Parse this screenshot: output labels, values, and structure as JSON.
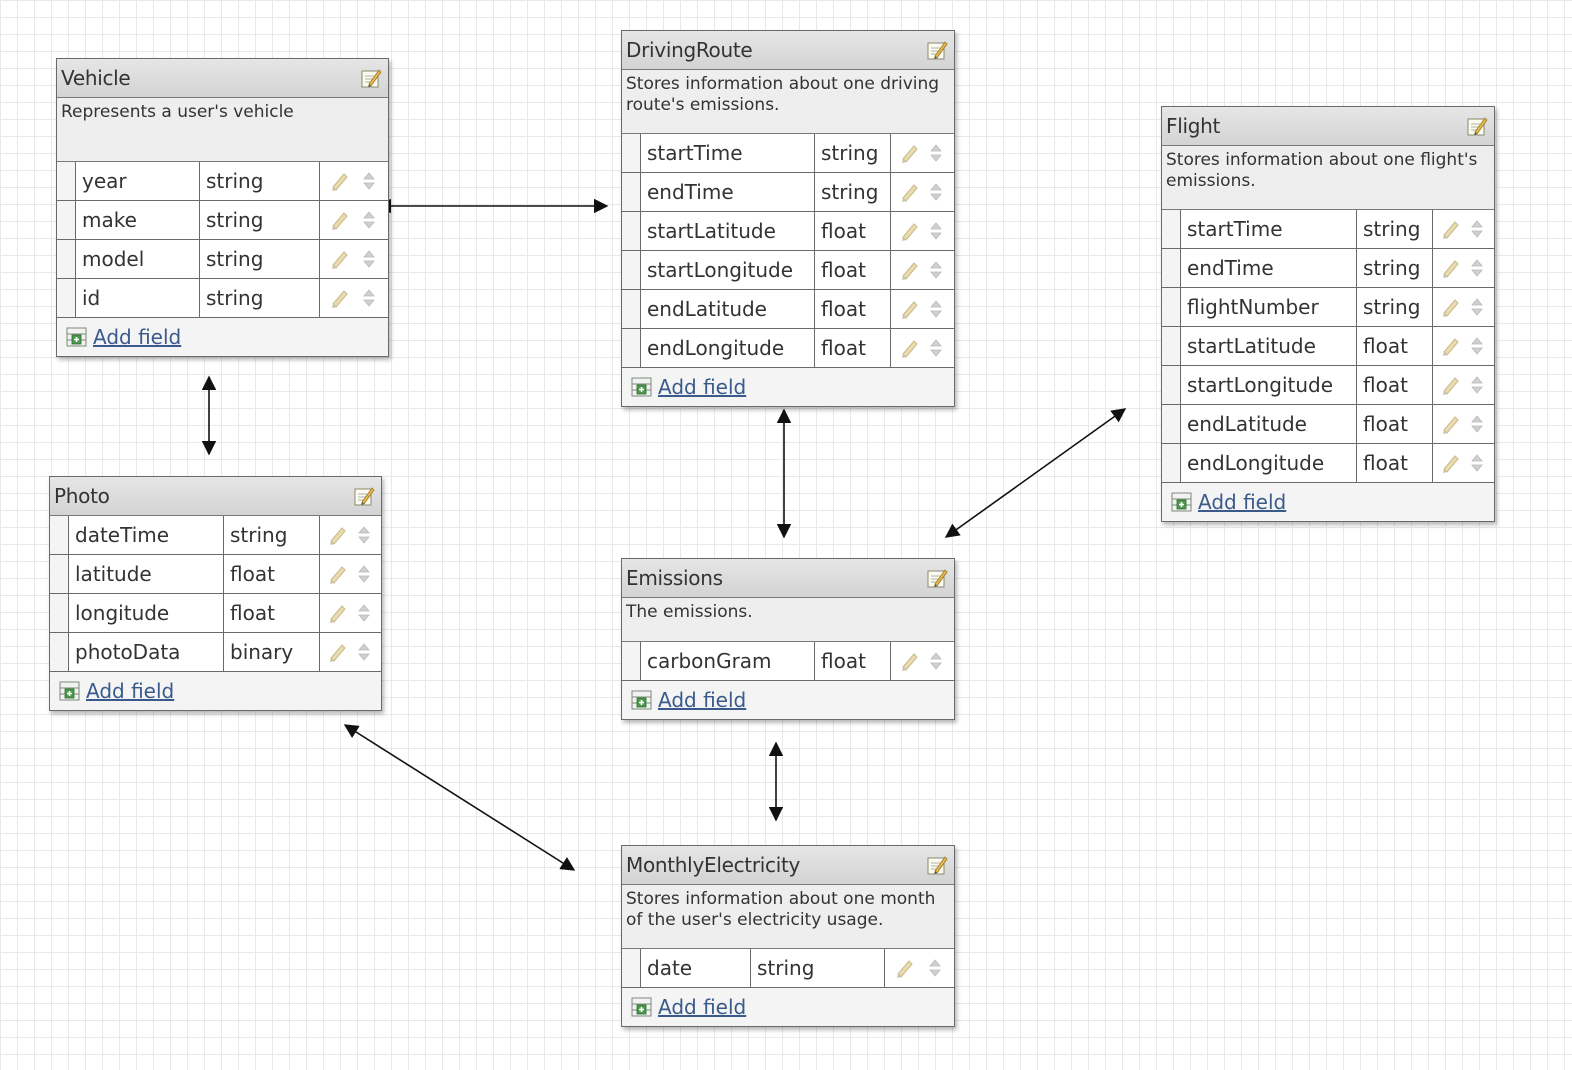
{
  "entities": {
    "vehicle": {
      "name": "Vehicle",
      "description": "Represents a user's vehicle",
      "fields": [
        {
          "name": "year",
          "type": "string"
        },
        {
          "name": "make",
          "type": "string"
        },
        {
          "name": "model",
          "type": "string"
        },
        {
          "name": "id",
          "type": "string"
        }
      ],
      "add_label": "Add field"
    },
    "driving_route": {
      "name": "DrivingRoute",
      "description": "Stores information about one driving route's emissions.",
      "fields": [
        {
          "name": "startTime",
          "type": "string"
        },
        {
          "name": "endTime",
          "type": "string"
        },
        {
          "name": "startLatitude",
          "type": "float"
        },
        {
          "name": "startLongitude",
          "type": "float"
        },
        {
          "name": "endLatitude",
          "type": "float"
        },
        {
          "name": "endLongitude",
          "type": "float"
        }
      ],
      "add_label": "Add field"
    },
    "flight": {
      "name": "Flight",
      "description": "Stores information about one flight's emissions.",
      "fields": [
        {
          "name": "startTime",
          "type": "string"
        },
        {
          "name": "endTime",
          "type": "string"
        },
        {
          "name": "flightNumber",
          "type": "string"
        },
        {
          "name": "startLatitude",
          "type": "float"
        },
        {
          "name": "startLongitude",
          "type": "float"
        },
        {
          "name": "endLatitude",
          "type": "float"
        },
        {
          "name": "endLongitude",
          "type": "float"
        }
      ],
      "add_label": "Add field"
    },
    "photo": {
      "name": "Photo",
      "fields": [
        {
          "name": "dateTime",
          "type": "string"
        },
        {
          "name": "latitude",
          "type": "float"
        },
        {
          "name": "longitude",
          "type": "float"
        },
        {
          "name": "photoData",
          "type": "binary"
        }
      ],
      "add_label": "Add field"
    },
    "emissions": {
      "name": "Emissions",
      "description": "The emissions.",
      "fields": [
        {
          "name": "carbonGram",
          "type": "float"
        }
      ],
      "add_label": "Add field"
    },
    "monthly_electricity": {
      "name": "MonthlyElectricity",
      "description": "Stores information about one month of the user's electricity usage.",
      "fields": [
        {
          "name": "date",
          "type": "string"
        }
      ],
      "add_label": "Add field"
    }
  },
  "colors": {
    "link": "#3a5a8c",
    "border": "#6a6a6a",
    "header": "#d9d9d9"
  },
  "icons": {
    "edit": "edit-entity-icon",
    "pencil": "pencil-icon",
    "sort": "sort-arrows-icon",
    "add": "add-field-icon"
  }
}
